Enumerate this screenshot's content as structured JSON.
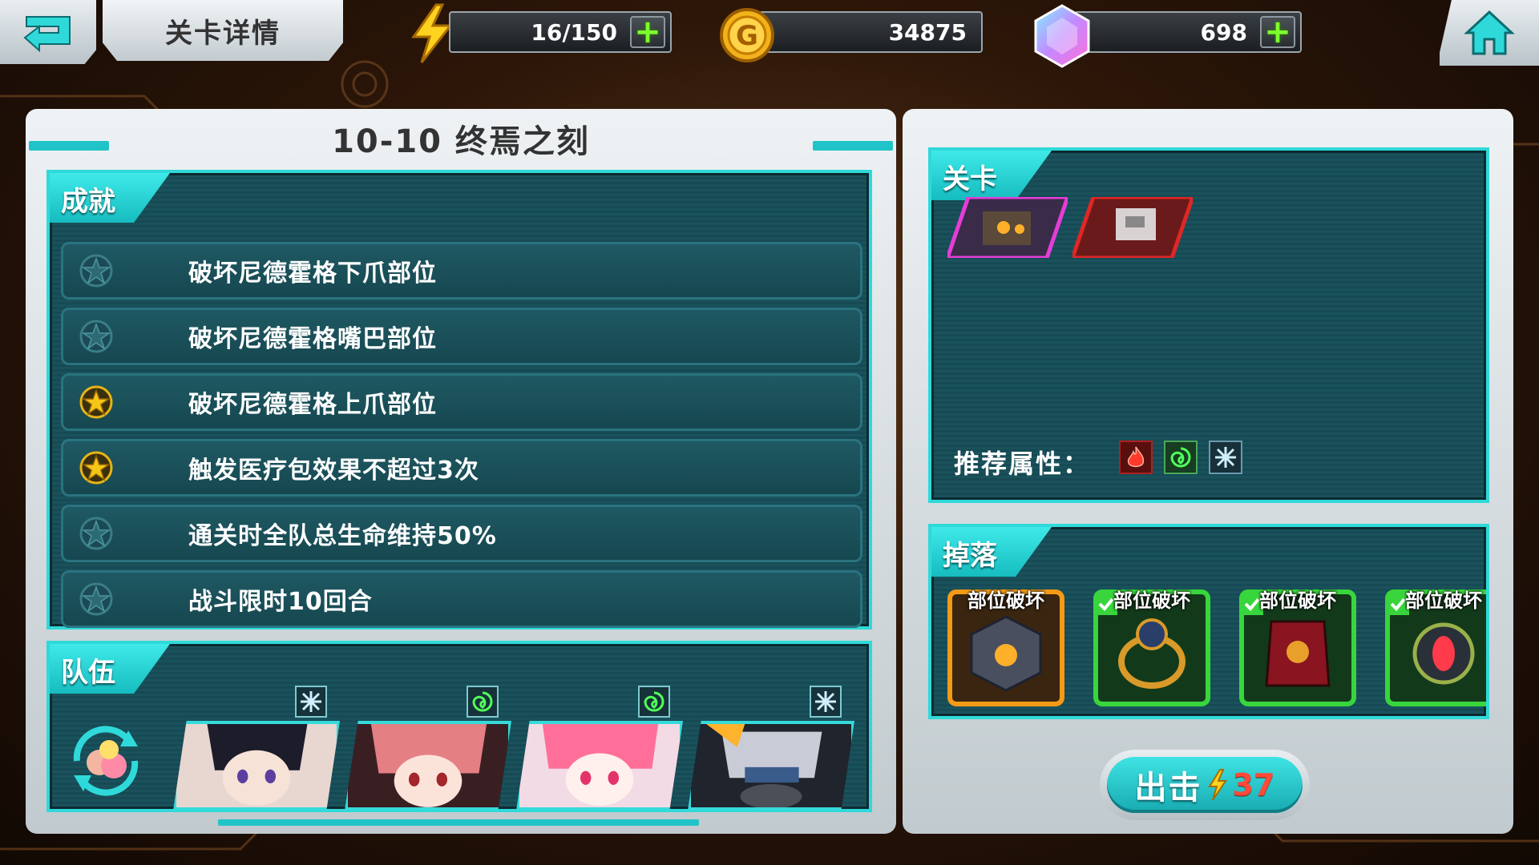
{
  "topbar": {
    "screen_title": "关卡详情",
    "energy": "16/150",
    "gold": "34875",
    "gems": "698"
  },
  "icons": {
    "back": "back-arrow-icon",
    "energy": "lightning-icon",
    "gold": "gold-coin-icon",
    "gems": "crystal-icon",
    "home": "home-icon"
  },
  "left": {
    "stage_title": "10-10  终焉之刻",
    "achievements_tag": "成就",
    "achievements": [
      {
        "text": "破坏尼德霍格下爪部位",
        "done": false
      },
      {
        "text": "破坏尼德霍格嘴巴部位",
        "done": false
      },
      {
        "text": "破坏尼德霍格上爪部位",
        "done": true
      },
      {
        "text": "触发医疗包效果不超过3次",
        "done": true
      },
      {
        "text": "通关时全队总生命维持50%",
        "done": false
      },
      {
        "text": "战斗限时10回合",
        "done": false
      }
    ],
    "team_tag": "队伍",
    "team": [
      {
        "element": "ice"
      },
      {
        "element": "wind"
      },
      {
        "element": "wind"
      },
      {
        "element": "ice"
      }
    ]
  },
  "right": {
    "stage_tag": "关卡",
    "recommend_label": "推荐属性：",
    "recommend_elements": [
      "fire",
      "wind",
      "ice"
    ],
    "drops_tag": "掉落",
    "drops": [
      {
        "label": "部位破坏",
        "rarity": "orange"
      },
      {
        "label": "部位破坏",
        "rarity": "green"
      },
      {
        "label": "部位破坏",
        "rarity": "green"
      },
      {
        "label": "部位破坏",
        "rarity": "green"
      }
    ],
    "go_label": "出击",
    "go_cost": "37"
  },
  "colors": {
    "accent_teal": "#2fd9d9",
    "energy_cost": "#ff4a3a",
    "star_done": "#f5c518",
    "plus_green": "#7dff2e"
  }
}
